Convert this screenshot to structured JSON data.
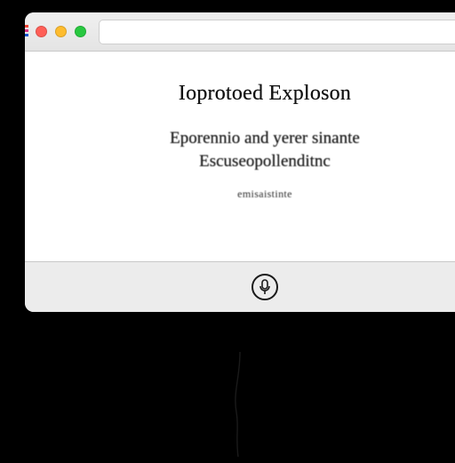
{
  "window": {
    "traffic_lights": {
      "close": {
        "color": "#ff5f57"
      },
      "minimize": {
        "color": "#febc2e"
      },
      "zoom": {
        "color": "#28c840"
      }
    },
    "url": ""
  },
  "content": {
    "heading": "Ioprotoed Exploson",
    "line1": "Eporennio and yerer sinante",
    "line2": "Escuseopollenditnc",
    "footnote": "emisaistinte"
  },
  "icons": {
    "footer_button": "microphone-icon"
  }
}
